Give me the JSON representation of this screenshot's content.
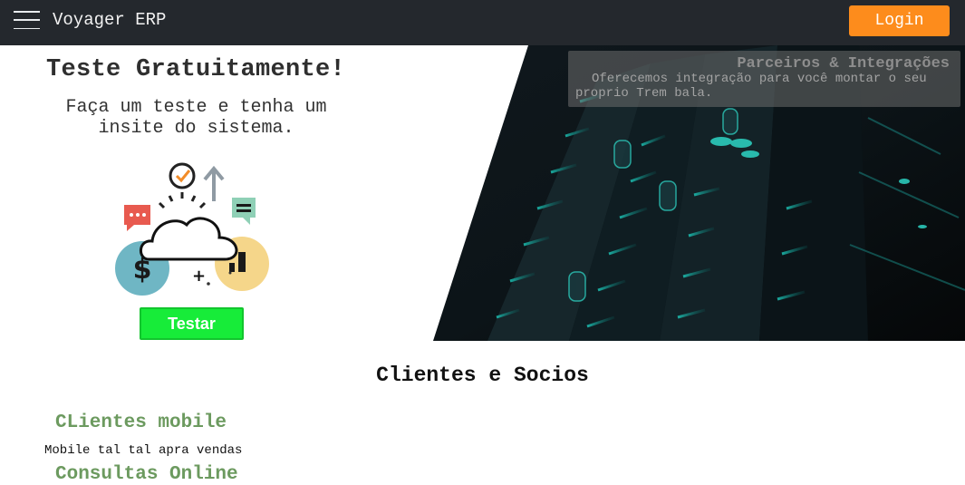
{
  "navbar": {
    "brand": "Voyager ERP",
    "login_label": "Login",
    "menu_icon": "hamburger-menu-icon"
  },
  "trial": {
    "title": "Teste Gratuitamente!",
    "subtitle": "Faça um teste e tenha um insite do sistema.",
    "button_label": "Testar",
    "illustration_icons": [
      "cloud-icon",
      "dollar-coin-icon",
      "bar-chart-coin-icon",
      "chat-bubble-icon",
      "message-icon",
      "check-clock-icon",
      "arrow-up-icon"
    ]
  },
  "hero": {
    "partner_title": "Parceiros & Integrações",
    "partner_text": "Oferecemos integração para você montar o seu proprio Trem bala."
  },
  "clients": {
    "section_title": "Clientes e Socios",
    "items": [
      {
        "title": "CLientes mobile",
        "description": "Mobile tal tal apra vendas"
      },
      {
        "title": "Consultas Online"
      }
    ]
  },
  "colors": {
    "navbar_bg": "#24282d",
    "login_button": "#fd8c1c",
    "test_button": "#17ec39",
    "client_title": "#6c9a5f",
    "hero_accent": "#1fd8c8"
  }
}
